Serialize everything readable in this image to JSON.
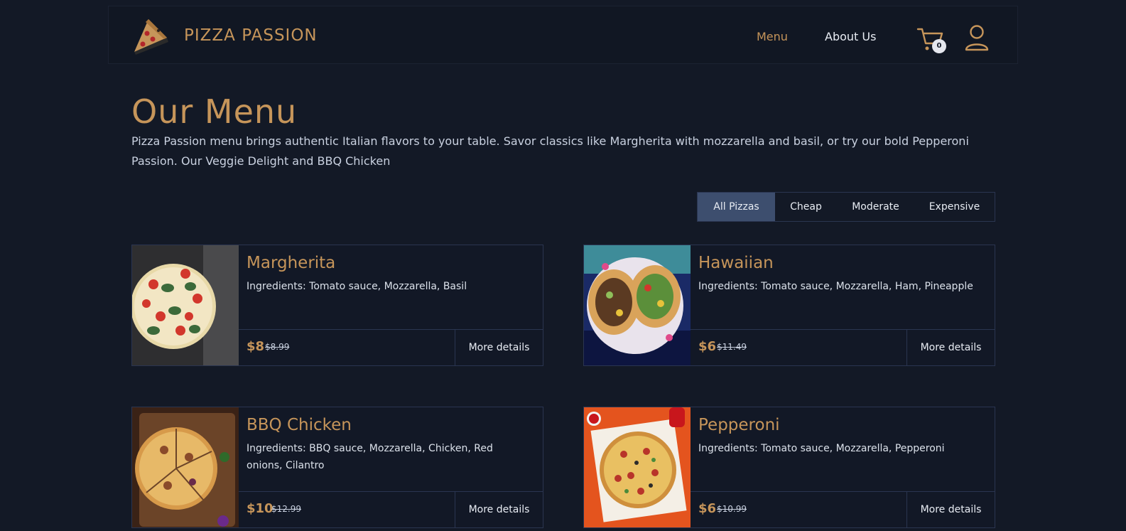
{
  "header": {
    "brand": "PIZZA PASSION",
    "nav": {
      "menu": "Menu",
      "about": "About Us"
    },
    "cart_count": "0"
  },
  "main": {
    "title": "Our Menu",
    "description": "Pizza Passion menu brings authentic Italian flavors to your table. Savor classics like Margherita with mozzarella and basil, or try our bold Pepperoni Passion. Our Veggie Delight and BBQ Chicken"
  },
  "filters": [
    "All Pizzas",
    "Cheap",
    "Moderate",
    "Expensive"
  ],
  "active_filter": "All Pizzas",
  "products": [
    {
      "name": "Margherita",
      "ingredients": "Ingredients: Tomato sauce, Mozzarella, Basil",
      "price": "$8",
      "old_price": "$8.99",
      "button": "More details"
    },
    {
      "name": "Hawaiian",
      "ingredients": "Ingredients: Tomato sauce, Mozzarella, Ham, Pineapple",
      "price": "$6",
      "old_price": "$11.49",
      "button": "More details"
    },
    {
      "name": "BBQ Chicken",
      "ingredients": "Ingredients: BBQ sauce, Mozzarella, Chicken, Red onions, Cilantro",
      "price": "$10",
      "old_price": "$12.99",
      "button": "More details"
    },
    {
      "name": "Pepperoni",
      "ingredients": "Ingredients: Tomato sauce, Mozzarella, Pepperoni",
      "price": "$6",
      "old_price": "$10.99",
      "button": "More details"
    }
  ],
  "colors": {
    "accent": "#c6955a",
    "background": "#131926",
    "active_filter": "#3d4e6e",
    "border": "#2a3550"
  },
  "icons": [
    "pizza-logo-icon",
    "cart-icon",
    "user-icon"
  ]
}
